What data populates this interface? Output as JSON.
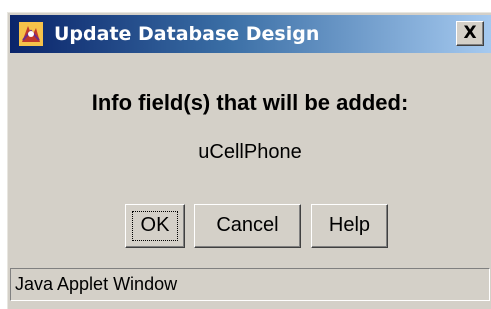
{
  "window": {
    "title": "Update Database Design",
    "close_label": "X",
    "icon": "java-cup-icon"
  },
  "dialog": {
    "heading": "Info field(s) that will be added:",
    "fields": [
      "uCellPhone"
    ]
  },
  "buttons": {
    "ok_label": "OK",
    "cancel_label": "Cancel",
    "help_label": "Help"
  },
  "status": {
    "text": "Java Applet Window"
  },
  "colors": {
    "dialog_background": "#d4d0c8",
    "titlebar_start": "#0a246a",
    "titlebar_end": "#a6caf0"
  }
}
